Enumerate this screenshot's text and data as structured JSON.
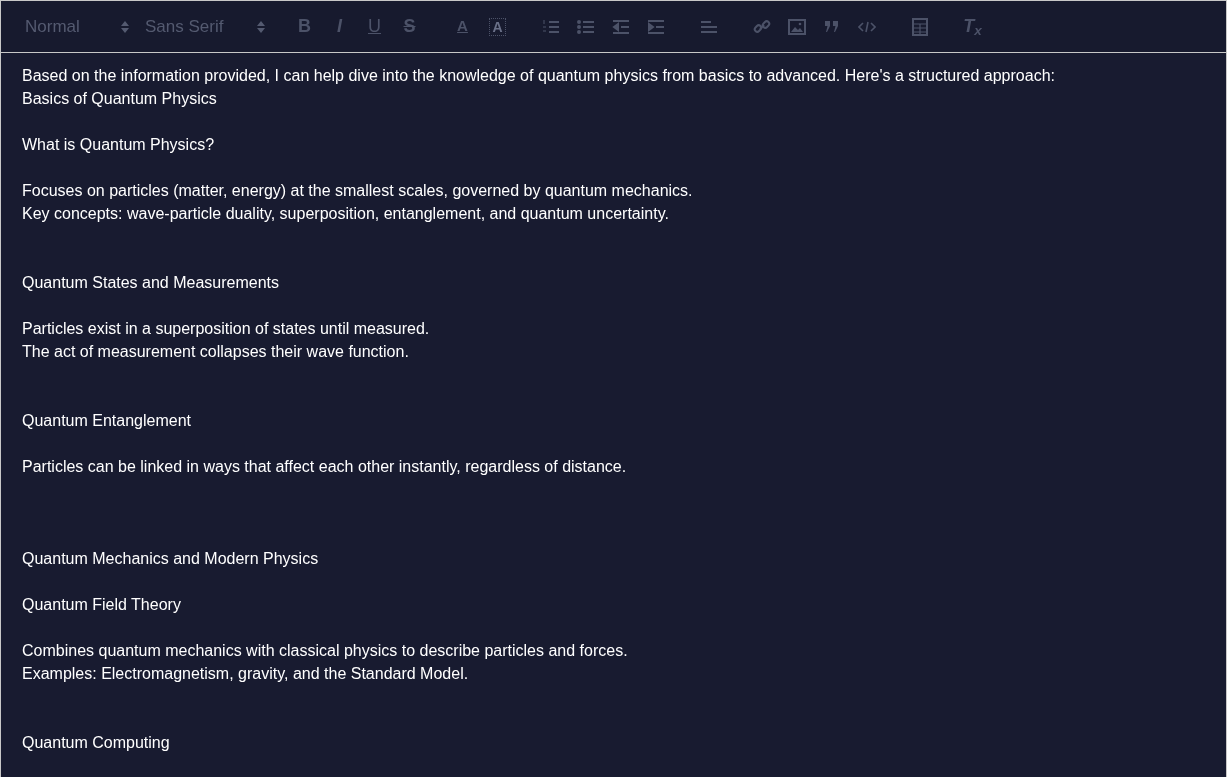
{
  "toolbar": {
    "selects": [
      {
        "kind": "header",
        "value": "Normal"
      },
      {
        "kind": "font",
        "value": "Sans Serif"
      }
    ],
    "groups": [
      [
        {
          "kind": "bold",
          "label": "B"
        },
        {
          "kind": "italic",
          "label": "I"
        },
        {
          "kind": "underline",
          "label": "U"
        },
        {
          "kind": "strike",
          "label": "S"
        }
      ],
      [
        {
          "kind": "color",
          "label": "A"
        },
        {
          "kind": "background",
          "label": "A"
        }
      ],
      [
        {
          "kind": "ordered-list"
        },
        {
          "kind": "bullet-list"
        },
        {
          "kind": "outdent"
        },
        {
          "kind": "indent"
        }
      ],
      [
        {
          "kind": "align"
        }
      ],
      [
        {
          "kind": "link"
        },
        {
          "kind": "image"
        },
        {
          "kind": "blockquote"
        },
        {
          "kind": "code-block"
        }
      ],
      [
        {
          "kind": "table"
        }
      ],
      [
        {
          "kind": "clean",
          "label": "T$_{x}$"
        }
      ]
    ]
  },
  "lines": [
    {
      "kind": "text",
      "text": "Based on the information provided, I can help dive into the knowledge of quantum physics from basics to advanced. Here's a structured approach:"
    },
    {
      "kind": "text",
      "text": "Basics of Quantum Physics"
    },
    {
      "kind": "blank"
    },
    {
      "kind": "text",
      "text": "What is Quantum Physics?"
    },
    {
      "kind": "blank"
    },
    {
      "kind": "text",
      "text": "Focuses on particles (matter, energy) at the smallest scales, governed by quantum mechanics."
    },
    {
      "kind": "text",
      "text": "Key concepts: wave-particle duality, superposition, entanglement, and quantum uncertainty."
    },
    {
      "kind": "blank"
    },
    {
      "kind": "blank"
    },
    {
      "kind": "text",
      "text": "Quantum States and Measurements"
    },
    {
      "kind": "blank"
    },
    {
      "kind": "text",
      "text": "Particles exist in a superposition of states until measured."
    },
    {
      "kind": "text",
      "text": "The act of measurement collapses their wave function."
    },
    {
      "kind": "blank"
    },
    {
      "kind": "blank"
    },
    {
      "kind": "text",
      "text": "Quantum Entanglement"
    },
    {
      "kind": "blank"
    },
    {
      "kind": "text",
      "text": "Particles can be linked in ways that affect each other instantly, regardless of distance."
    },
    {
      "kind": "blank"
    },
    {
      "kind": "blank"
    },
    {
      "kind": "blank"
    },
    {
      "kind": "text",
      "text": "Quantum Mechanics and Modern Physics"
    },
    {
      "kind": "blank"
    },
    {
      "kind": "text",
      "text": "Quantum Field Theory"
    },
    {
      "kind": "blank"
    },
    {
      "kind": "text",
      "text": "Combines quantum mechanics with classical physics to describe particles and forces."
    },
    {
      "kind": "text",
      "text": "Examples: Electromagnetism, gravity, and the Standard Model."
    },
    {
      "kind": "blank"
    },
    {
      "kind": "blank"
    },
    {
      "kind": "text",
      "text": "Quantum Computing"
    }
  ]
}
